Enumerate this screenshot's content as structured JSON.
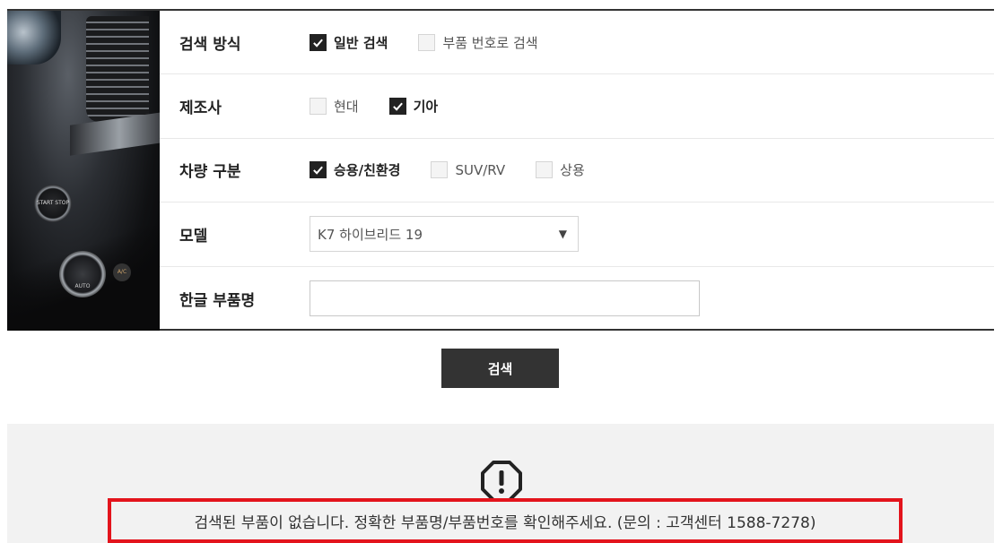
{
  "form": {
    "search_method": {
      "label": "검색 방식",
      "options": [
        {
          "label": "일반 검색",
          "checked": true
        },
        {
          "label": "부품 번호로 검색",
          "checked": false
        }
      ]
    },
    "manufacturer": {
      "label": "제조사",
      "options": [
        {
          "label": "현대",
          "checked": false
        },
        {
          "label": "기아",
          "checked": true
        }
      ]
    },
    "vehicle_type": {
      "label": "차량 구분",
      "options": [
        {
          "label": "승용/친환경",
          "checked": true
        },
        {
          "label": "SUV/RV",
          "checked": false
        },
        {
          "label": "상용",
          "checked": false
        }
      ]
    },
    "model": {
      "label": "모델",
      "selected": "K7 하이브리드 19"
    },
    "part_name": {
      "label": "한글 부품명",
      "value": ""
    }
  },
  "search_button": "검색",
  "result": {
    "icon": "warning-octagon-icon",
    "message": "검색된 부품이 없습니다. 정확한 부품명/부품번호를 확인해주세요. (문의 : 고객센터 1588-7278)",
    "highlight_color": "#e3141c"
  },
  "image_text": {
    "start_button": "START STOP",
    "knob": "AUTO",
    "ac": "A/C"
  },
  "colors": {
    "accent": "#333333",
    "border": "#d5d5d5",
    "result_bg": "#f2f2f2"
  }
}
